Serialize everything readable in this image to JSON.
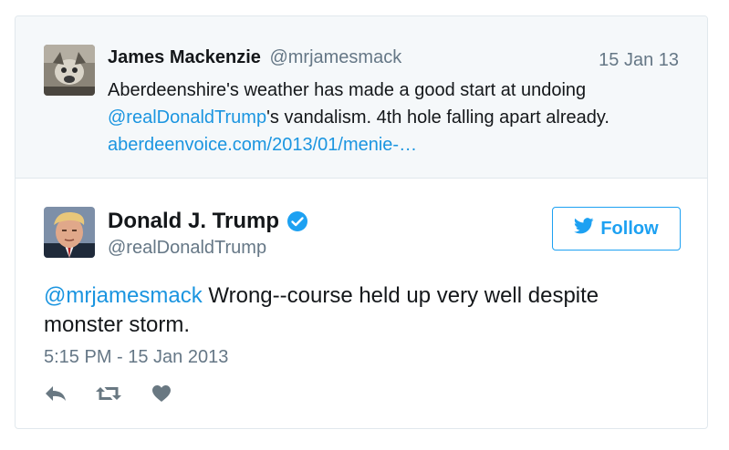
{
  "reply_context": {
    "author_name": "James Mackenzie",
    "author_handle": "@mrjamesmack",
    "date": "15 Jan 13",
    "text_before": "Aberdeenshire's weather has made a good start at undoing ",
    "mention": "@realDonaldTrump",
    "text_after": "'s vandalism. 4th hole falling apart already. ",
    "link": "aberdeenvoice.com/2013/01/menie-…"
  },
  "tweet": {
    "author_name": "Donald J. Trump",
    "author_handle": "@realDonaldTrump",
    "verified_icon": "verified-badge-icon",
    "follow_label": "Follow",
    "mention": "@mrjamesmack",
    "text": " Wrong--course held up very well despite monster storm.",
    "timestamp": "5:15 PM - 15 Jan 2013",
    "actions": [
      "reply-icon",
      "retweet-icon",
      "like-icon"
    ]
  },
  "colors": {
    "link": "#1b95e0",
    "brand": "#1da1f2",
    "muted": "#657786",
    "context_bg": "#f5f8fa",
    "border": "#e1e8ed",
    "action_icon": "#697882"
  }
}
